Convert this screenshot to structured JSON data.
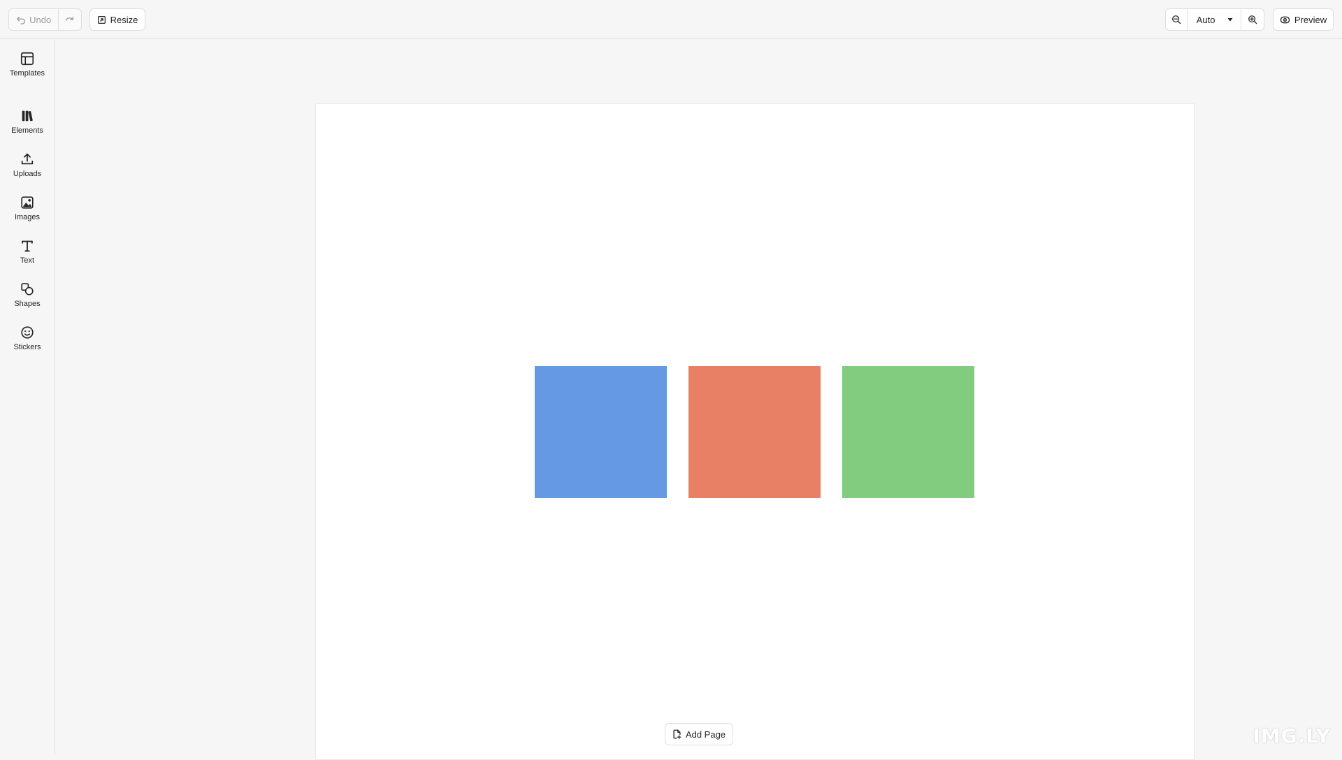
{
  "toolbar": {
    "undo_label": "Undo",
    "resize_label": "Resize",
    "zoom_value": "Auto",
    "preview_label": "Preview"
  },
  "sidebar": {
    "items": [
      {
        "label": "Templates",
        "icon": "templates-icon"
      },
      {
        "label": "Elements",
        "icon": "elements-icon"
      },
      {
        "label": "Uploads",
        "icon": "upload-icon"
      },
      {
        "label": "Images",
        "icon": "image-icon"
      },
      {
        "label": "Text",
        "icon": "text-icon"
      },
      {
        "label": "Shapes",
        "icon": "shapes-icon"
      },
      {
        "label": "Stickers",
        "icon": "sticker-icon"
      }
    ]
  },
  "canvas": {
    "shapes": [
      {
        "color": "#6699e3"
      },
      {
        "color": "#e88066"
      },
      {
        "color": "#82cc80"
      }
    ],
    "add_page_label": "Add Page"
  },
  "watermark": "IMG.LY"
}
